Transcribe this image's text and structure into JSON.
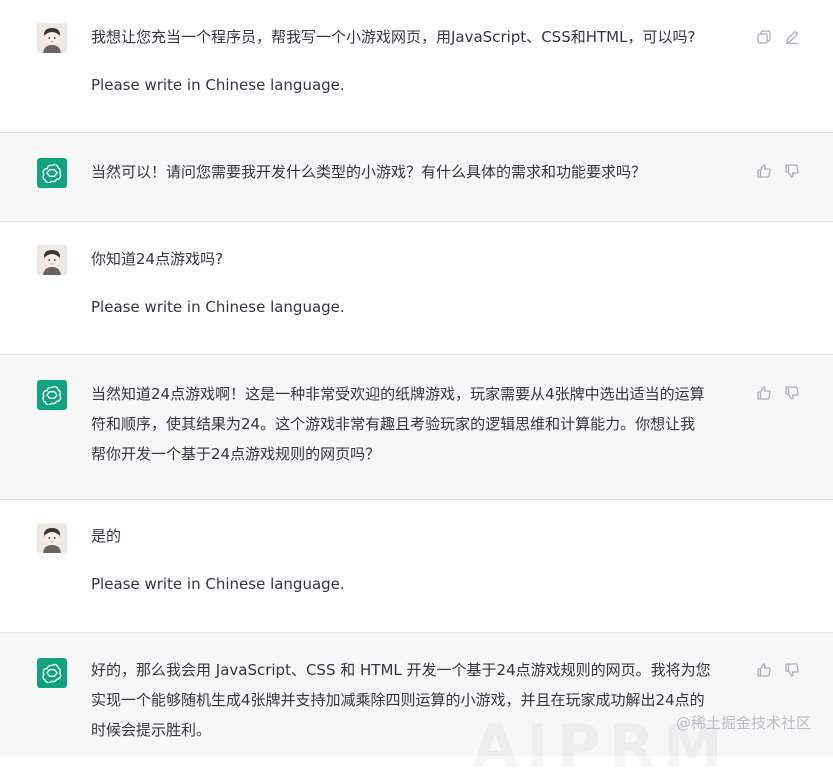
{
  "conversation": [
    {
      "role": "user",
      "lines": [
        "我想让您充当一个程序员，帮我写一个小游戏网页，用JavaScript、CSS和HTML，可以吗?"
      ],
      "note": "Please write in Chinese language."
    },
    {
      "role": "assistant",
      "lines": [
        "当然可以！请问您需要我开发什么类型的小游戏？有什么具体的需求和功能要求吗？"
      ]
    },
    {
      "role": "user",
      "lines": [
        "你知道24点游戏吗?"
      ],
      "note": "Please write in Chinese language."
    },
    {
      "role": "assistant",
      "lines": [
        "当然知道24点游戏啊！这是一种非常受欢迎的纸牌游戏，玩家需要从4张牌中选出适当的运算",
        "符和顺序，使其结果为24。这个游戏非常有趣且考验玩家的逻辑思维和计算能力。你想让我",
        "帮你开发一个基于24点游戏规则的网页吗？"
      ]
    },
    {
      "role": "user",
      "lines": [
        "是的"
      ],
      "note": "Please write in Chinese language."
    },
    {
      "role": "assistant",
      "lines": [
        "好的，那么我会用 JavaScript、CSS 和 HTML 开发一个基于24点游戏规则的网页。我将为您",
        "实现一个能够随机生成4张牌并支持加减乘除四则运算的小游戏，并且在玩家成功解出24点的",
        "时候会提示胜利。"
      ]
    }
  ],
  "icons": {
    "user_actions": [
      "copy-icon",
      "edit-icon"
    ],
    "bot_actions": [
      "thumbs-up-icon",
      "thumbs-down-icon"
    ]
  },
  "watermark": "@稀土掘金技术社区",
  "watermark_large": "AIPRM",
  "colors": {
    "bot_bg": "#f7f7f8",
    "avatar_green": "#10a37f",
    "text": "#343541",
    "icon_gray": "#acacbe"
  }
}
